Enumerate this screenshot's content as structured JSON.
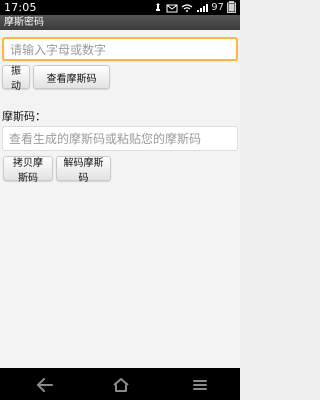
{
  "status_bar": {
    "time": "17:05",
    "battery_percent": "97",
    "icons": [
      "usb-icon",
      "mail-icon",
      "wifi-icon",
      "signal-icon",
      "battery-icon"
    ]
  },
  "title_bar": {
    "title": "摩斯密码"
  },
  "input": {
    "placeholder": "请输入字母或数字"
  },
  "buttons": {
    "vibrate": "振动",
    "view_morse": "查看摩斯码",
    "copy_morse": "拷贝摩斯码",
    "decode_morse": "解码摩斯码"
  },
  "section": {
    "morse_label": "摩斯码："
  },
  "output": {
    "placeholder": "查看生成的摩斯码或粘贴您的摩斯码"
  },
  "nav_bar": {
    "icons": [
      "back-icon",
      "home-icon",
      "menu-icon"
    ]
  }
}
